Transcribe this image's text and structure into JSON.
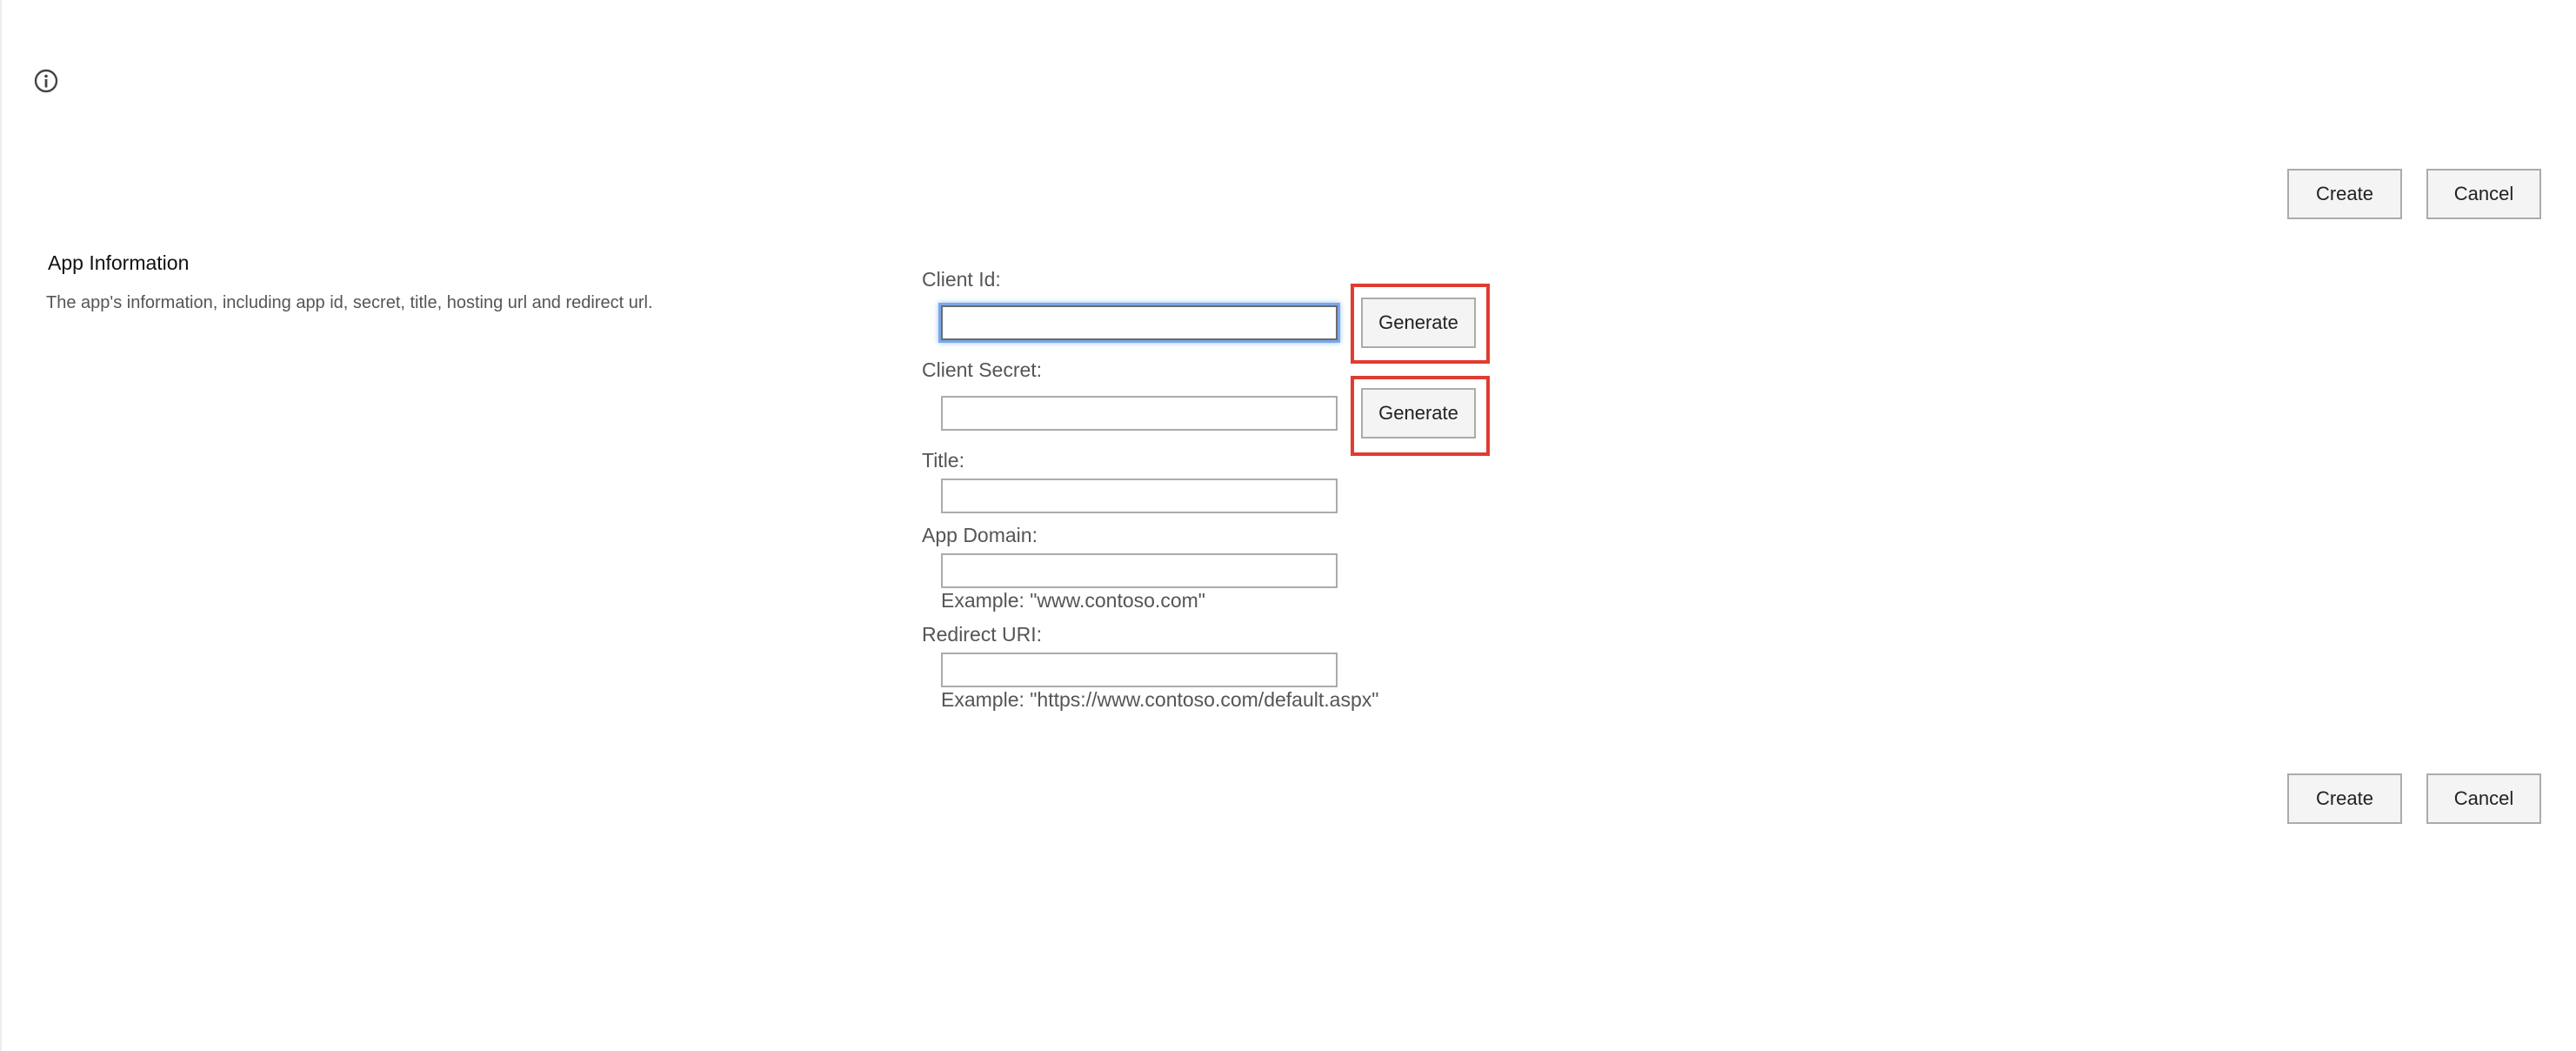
{
  "header": {
    "info_icon": "info-circle-icon"
  },
  "toolbar_top": {
    "create_label": "Create",
    "cancel_label": "Cancel"
  },
  "section": {
    "title": "App Information",
    "description": "The app's information, including app id, secret, title, hosting url and redirect url."
  },
  "form": {
    "client_id": {
      "label": "Client Id:",
      "value": "",
      "generate_label": "Generate"
    },
    "client_secret": {
      "label": "Client Secret:",
      "value": "",
      "generate_label": "Generate"
    },
    "title": {
      "label": "Title:",
      "value": ""
    },
    "app_domain": {
      "label": "App Domain:",
      "value": "",
      "example": "Example: \"www.contoso.com\""
    },
    "redirect_uri": {
      "label": "Redirect URI:",
      "value": "",
      "example": "Example: \"https://www.contoso.com/default.aspx\""
    }
  },
  "toolbar_bottom": {
    "create_label": "Create",
    "cancel_label": "Cancel"
  },
  "colors": {
    "highlight": "#e03c31",
    "focus_ring": "#7aa7e8",
    "button_bg": "#f4f4f4",
    "button_border": "#ababab"
  }
}
